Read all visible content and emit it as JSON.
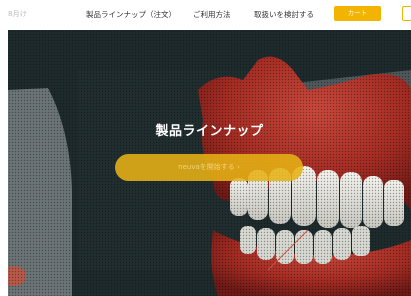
{
  "header": {
    "brand": "8月け",
    "nav": [
      {
        "label": "製品ラインナップ（注文）"
      },
      {
        "label": "ご利用方法"
      },
      {
        "label": "取扱いを検討する"
      }
    ],
    "cart_label": "カート"
  },
  "hero": {
    "title": "製品ラインナップ",
    "cta_label": "neuvaを開始する ›"
  },
  "colors": {
    "accent": "#f2b400",
    "hero_bg": "#1f2c2e",
    "gum": "#b8342a",
    "teeth": "#e8e8e4"
  }
}
